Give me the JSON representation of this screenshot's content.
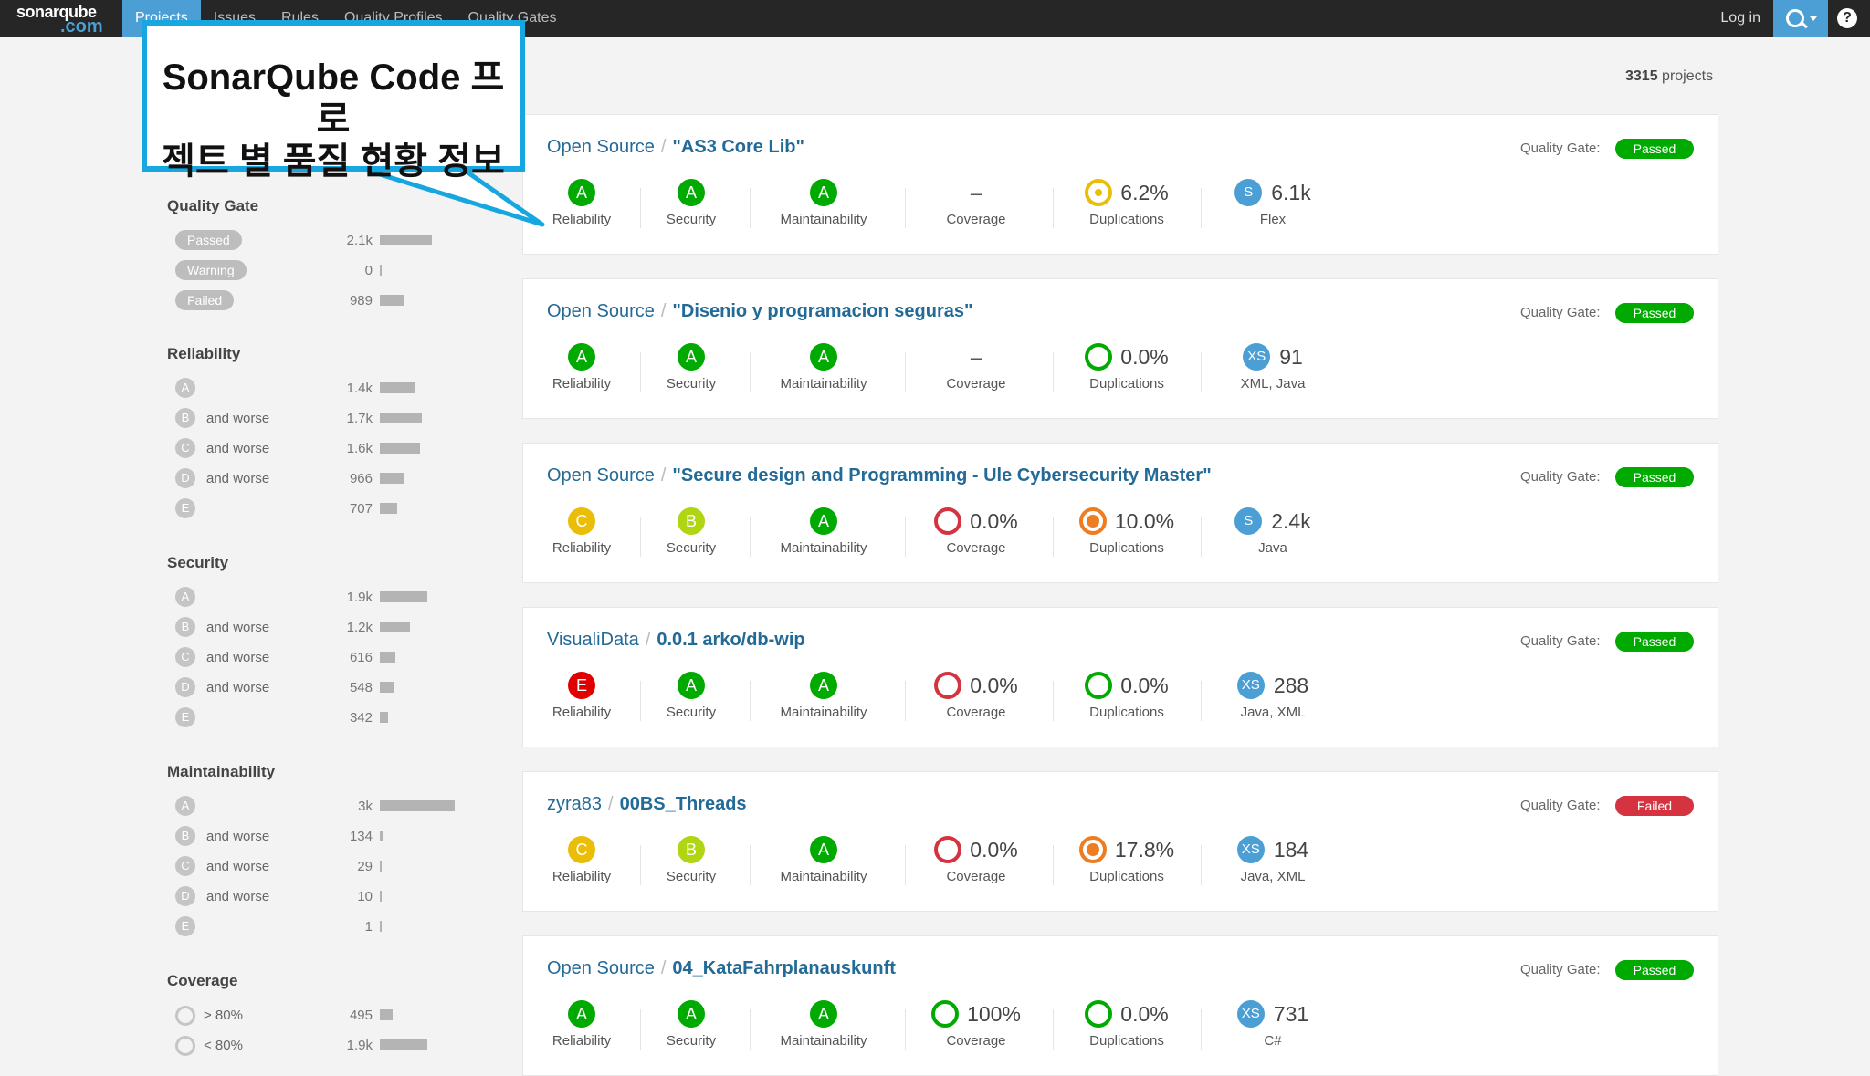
{
  "topbar": {
    "logo_line1": "sonarqube",
    "logo_line2": ".com",
    "nav": [
      "Projects",
      "Issues",
      "Rules",
      "Quality Profiles",
      "Quality Gates"
    ],
    "login": "Log in",
    "help": "?"
  },
  "callout": {
    "line1": "SonarQube Code 프로",
    "line2": "젝트 별 품질 현황 정보"
  },
  "sidebar": {
    "quality_gate": {
      "title": "Quality Gate",
      "rows": [
        {
          "label": "Passed",
          "count": "2.1k",
          "value": 2100
        },
        {
          "label": "Warning",
          "count": "0",
          "value": 0
        },
        {
          "label": "Failed",
          "count": "989",
          "value": 989
        }
      ]
    },
    "reliability": {
      "title": "Reliability",
      "rows": [
        {
          "rating": "A",
          "suffix": "",
          "count": "1.4k",
          "value": 1400
        },
        {
          "rating": "B",
          "suffix": "and worse",
          "count": "1.7k",
          "value": 1700
        },
        {
          "rating": "C",
          "suffix": "and worse",
          "count": "1.6k",
          "value": 1600
        },
        {
          "rating": "D",
          "suffix": "and worse",
          "count": "966",
          "value": 966
        },
        {
          "rating": "E",
          "suffix": "",
          "count": "707",
          "value": 707
        }
      ]
    },
    "security": {
      "title": "Security",
      "rows": [
        {
          "rating": "A",
          "suffix": "",
          "count": "1.9k",
          "value": 1900
        },
        {
          "rating": "B",
          "suffix": "and worse",
          "count": "1.2k",
          "value": 1200
        },
        {
          "rating": "C",
          "suffix": "and worse",
          "count": "616",
          "value": 616
        },
        {
          "rating": "D",
          "suffix": "and worse",
          "count": "548",
          "value": 548
        },
        {
          "rating": "E",
          "suffix": "",
          "count": "342",
          "value": 342
        }
      ]
    },
    "maintainability": {
      "title": "Maintainability",
      "rows": [
        {
          "rating": "A",
          "suffix": "",
          "count": "3k",
          "value": 3000
        },
        {
          "rating": "B",
          "suffix": "and worse",
          "count": "134",
          "value": 134
        },
        {
          "rating": "C",
          "suffix": "and worse",
          "count": "29",
          "value": 29
        },
        {
          "rating": "D",
          "suffix": "and worse",
          "count": "10",
          "value": 10
        },
        {
          "rating": "E",
          "suffix": "",
          "count": "1",
          "value": 1
        }
      ]
    },
    "coverage": {
      "title": "Coverage",
      "rows": [
        {
          "label": "> 80%",
          "count": "495",
          "value": 495
        },
        {
          "label": "< 80%",
          "count": "1.9k",
          "value": 1900
        }
      ]
    }
  },
  "main": {
    "project_count": "3315",
    "project_count_label": "projects",
    "quality_gate_label": "Quality Gate:",
    "metric_labels": {
      "reliability": "Reliability",
      "security": "Security",
      "maintainability": "Maintainability",
      "coverage": "Coverage",
      "duplications": "Duplications"
    },
    "projects": [
      {
        "org": "Open Source",
        "name": "\"AS3 Core Lib\"",
        "gate": "Passed",
        "reliability": "A",
        "security": "A",
        "maintainability": "A",
        "coverage": null,
        "coverage_fraction": null,
        "duplications": "6.2%",
        "dup_level": "low",
        "size_badge": "S",
        "size": "6.1k",
        "languages": "Flex"
      },
      {
        "org": "Open Source",
        "name": "\"Disenio y programacion seguras\"",
        "gate": "Passed",
        "reliability": "A",
        "security": "A",
        "maintainability": "A",
        "coverage": null,
        "coverage_fraction": null,
        "duplications": "0.0%",
        "dup_level": "good",
        "size_badge": "XS",
        "size": "91",
        "languages": "XML, Java"
      },
      {
        "org": "Open Source",
        "name": "\"Secure design and Programming - Ule Cybersecurity Master\"",
        "gate": "Passed",
        "reliability": "C",
        "security": "B",
        "maintainability": "A",
        "coverage": "0.0%",
        "coverage_fraction": 0,
        "duplications": "10.0%",
        "dup_level": "high",
        "size_badge": "S",
        "size": "2.4k",
        "languages": "Java"
      },
      {
        "org": "VisualiData",
        "name": "0.0.1 arko/db-wip",
        "gate": "Passed",
        "reliability": "E",
        "security": "A",
        "maintainability": "A",
        "coverage": "0.0%",
        "coverage_fraction": 0,
        "duplications": "0.0%",
        "dup_level": "good",
        "size_badge": "XS",
        "size": "288",
        "languages": "Java, XML"
      },
      {
        "org": "zyra83",
        "name": "00BS_Threads",
        "gate": "Failed",
        "reliability": "C",
        "security": "B",
        "maintainability": "A",
        "coverage": "0.0%",
        "coverage_fraction": 0,
        "duplications": "17.8%",
        "dup_level": "high",
        "size_badge": "XS",
        "size": "184",
        "languages": "Java, XML"
      },
      {
        "org": "Open Source",
        "name": "04_KataFahrplanauskunft",
        "gate": "Passed",
        "reliability": "A",
        "security": "A",
        "maintainability": "A",
        "coverage": "100%",
        "coverage_fraction": 1,
        "duplications": "0.0%",
        "dup_level": "good",
        "size_badge": "XS",
        "size": "731",
        "languages": "C#"
      }
    ]
  },
  "colors": {
    "rating": {
      "A": "#00aa00",
      "B": "#b0d513",
      "C": "#eabe06",
      "D": "#ed7d20",
      "E": "#e00000"
    },
    "accent": "#4b9fd5",
    "callout_border": "#16a6e0",
    "passed": "#00aa00",
    "failed": "#d4333f",
    "coverage_bad": "#d4333f",
    "coverage_good": "#00aa00",
    "dup_good": "#00aa00",
    "dup_low": "#eabe06",
    "dup_high": "#ed7d20"
  },
  "icons": {
    "search": "search-icon",
    "help": "help-icon",
    "caret": "caret-down-icon"
  }
}
